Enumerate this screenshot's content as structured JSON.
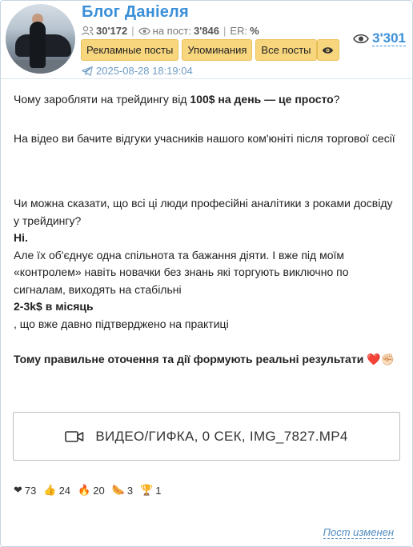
{
  "channel": {
    "title": "Блог Даніеля",
    "subscribers": "30'172",
    "per_post_label": "на пост:",
    "per_post": "3'846",
    "er_label": "ER:",
    "er_value": "%",
    "total_views": "3'301",
    "post_date": "2025-08-28 18:19:04"
  },
  "buttons": {
    "ads": "Рекламные посты",
    "mentions": "Упоминания",
    "all": "Все посты"
  },
  "post": {
    "l1_pre": "Чому заробляти на трейдингу від ",
    "l1_bold": "100$ на день — це просто",
    "l1_post": "?",
    "p2": "На відео ви бачите відгуки учасників нашого ком'юніті після торгової сесії",
    "p3": "Чи можна сказати, що всі ці люди професійні аналітики з роками досвіду у трейдингу?",
    "p4": "Ні.",
    "p5": "Але їх об'єднує одна спільнота та бажання діяти. І вже під моїм «контролем» навіть новачки без знань які торгують виключно по сигналам, виходять на стабільні",
    "p6": "2-3k$ в місяць",
    "p7": ", що вже давно підтверджено на практиці",
    "p8": "Тому правильне оточення та дії формують реальні результати",
    "p8_emoji": "❤️✊🏻"
  },
  "media": {
    "label": "ВИДЕО/ГИФКА, 0 СЕК, IMG_7827.MP4",
    "icon": "video-camera-icon"
  },
  "reactions": [
    {
      "emoji": "❤",
      "count": "73",
      "icon": "heart-icon"
    },
    {
      "emoji": "👍",
      "count": "24",
      "icon": "thumbs-up-icon"
    },
    {
      "emoji": "🔥",
      "count": "20",
      "icon": "fire-icon"
    },
    {
      "emoji": "🌭",
      "count": "3",
      "icon": "hotdog-icon"
    },
    {
      "emoji": "🏆",
      "count": "1",
      "icon": "trophy-icon"
    }
  ],
  "footer": {
    "edited": "Пост изменен"
  },
  "colors": {
    "accent": "#3a8fd8",
    "button_bg": "#f8d67e",
    "border": "#c7d6e3"
  }
}
